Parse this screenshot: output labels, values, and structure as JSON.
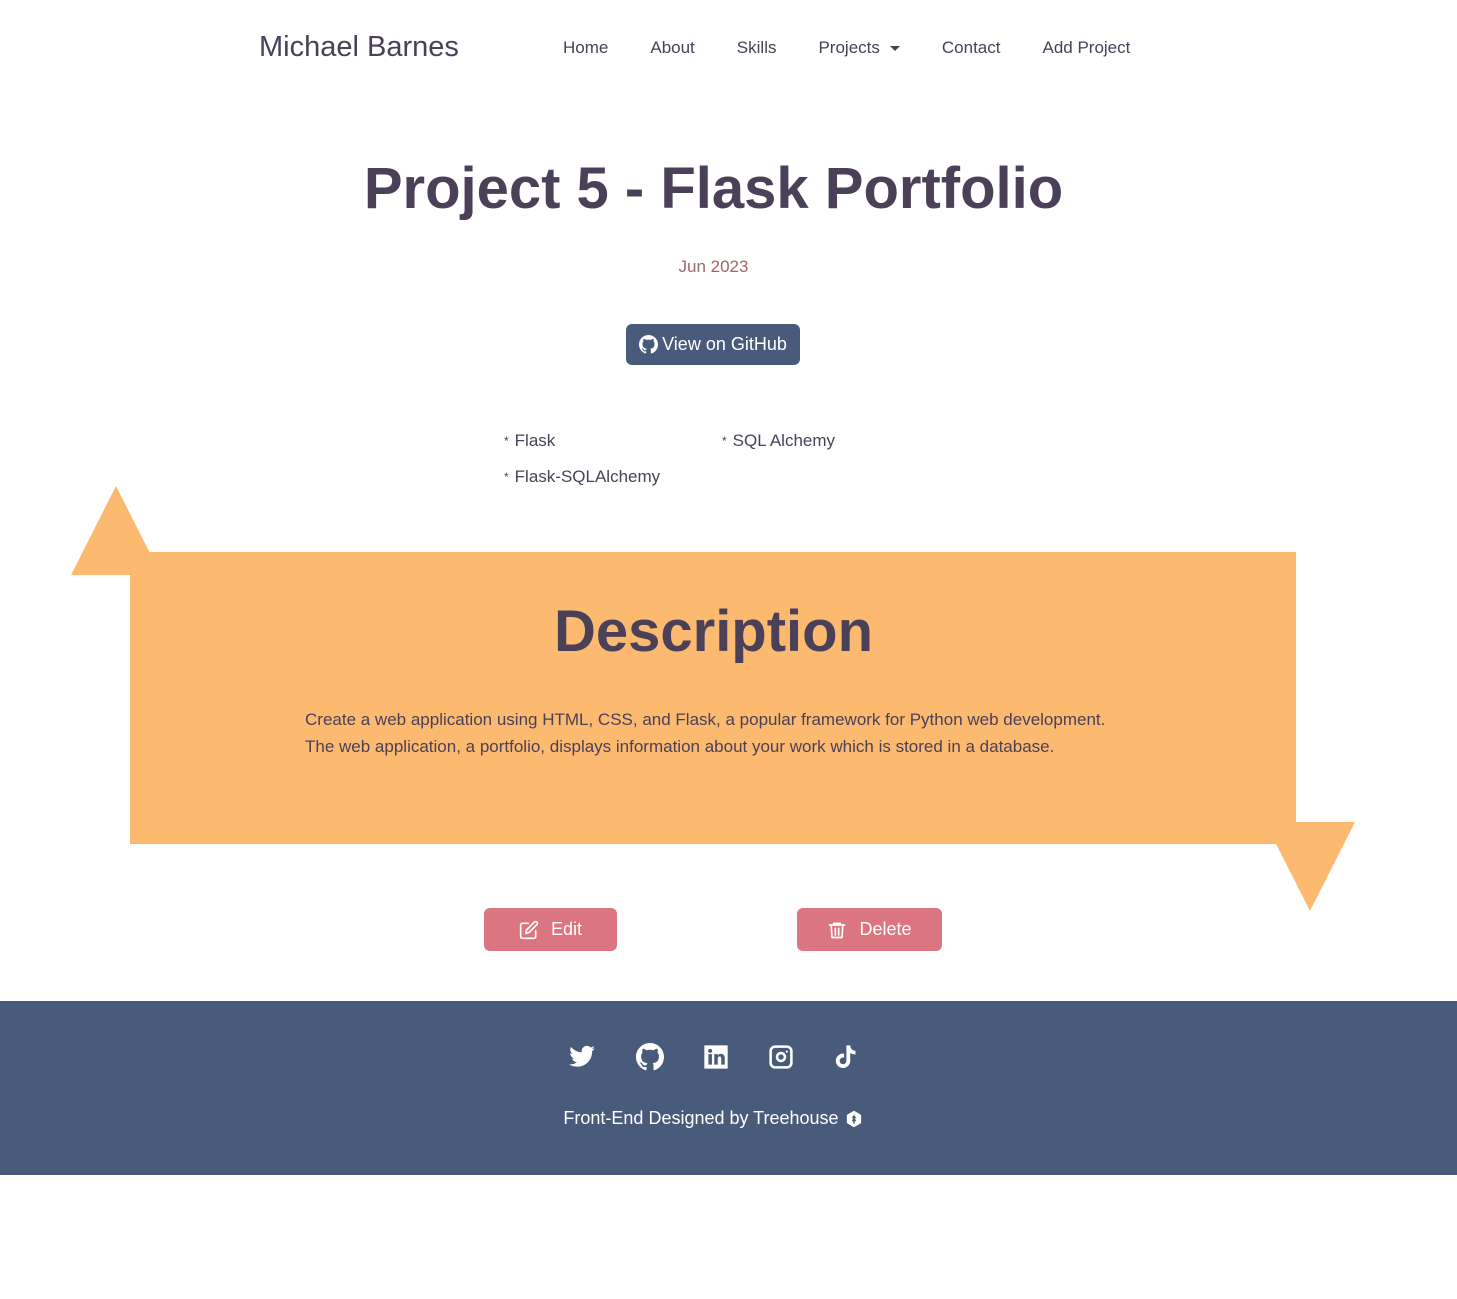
{
  "navbar": {
    "brand": "Michael Barnes",
    "links": [
      {
        "label": "Home"
      },
      {
        "label": "About"
      },
      {
        "label": "Skills"
      },
      {
        "label": "Projects"
      },
      {
        "label": "Contact"
      },
      {
        "label": "Add Project"
      }
    ]
  },
  "project": {
    "title": "Project 5 - Flask Portfolio",
    "date": "Jun 2023",
    "github_label": "View on GitHub",
    "skills": [
      "Flask",
      "SQL Alchemy",
      "Flask-SQLAlchemy"
    ]
  },
  "description": {
    "heading": "Description",
    "text": "Create a web application using HTML, CSS, and Flask, a popular framework for Python web development. The web application, a portfolio, displays information about your work which is stored in a database."
  },
  "actions": {
    "edit_label": "Edit",
    "delete_label": "Delete"
  },
  "footer": {
    "social_icons": [
      "twitter-icon",
      "github-icon",
      "linkedin-icon",
      "instagram-icon",
      "tiktok-icon"
    ],
    "credit": "Front-End Designed by Treehouse"
  },
  "colors": {
    "primary": "#4a4058",
    "accent_orange": "#fcba70",
    "button_blue": "#485b7b",
    "button_pink": "#db7580",
    "date_color": "#a0656d"
  }
}
